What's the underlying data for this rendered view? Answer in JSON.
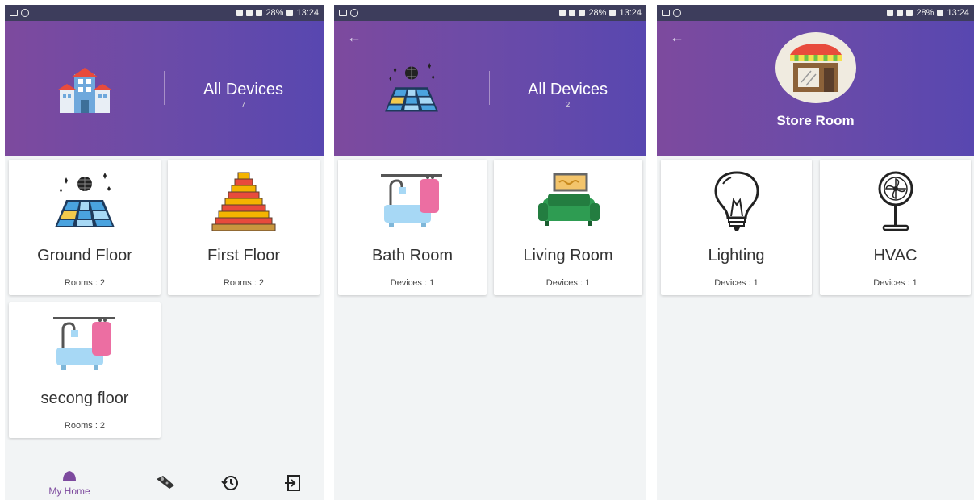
{
  "status": {
    "battery": "28%",
    "time": "13:24"
  },
  "screen1": {
    "header": {
      "title": "All Devices",
      "count": "7"
    },
    "cards": [
      {
        "title": "Ground Floor",
        "sub": "Rooms : 2",
        "icon": "disco-floor-icon"
      },
      {
        "title": "First Floor",
        "sub": "Rooms : 2",
        "icon": "stair-floor-icon"
      },
      {
        "title": "secong floor",
        "sub": "Rooms : 2",
        "icon": "bath-icon"
      }
    ],
    "nav": {
      "home_label": "My Home"
    }
  },
  "screen2": {
    "header": {
      "title": "All Devices",
      "count": "2"
    },
    "cards": [
      {
        "title": "Bath Room",
        "sub": "Devices : 1",
        "icon": "bath-icon"
      },
      {
        "title": "Living Room",
        "sub": "Devices : 1",
        "icon": "sofa-icon"
      }
    ]
  },
  "screen3": {
    "header": {
      "title": "Store Room"
    },
    "cards": [
      {
        "title": "Lighting",
        "sub": "Devices : 1",
        "icon": "bulb-icon"
      },
      {
        "title": "HVAC",
        "sub": "Devices : 1",
        "icon": "fan-icon"
      }
    ]
  },
  "colors": {
    "header_start": "#7d4a9e",
    "header_end": "#5847b0",
    "accent": "#7d4a9e",
    "background": "#f2f4f5"
  }
}
